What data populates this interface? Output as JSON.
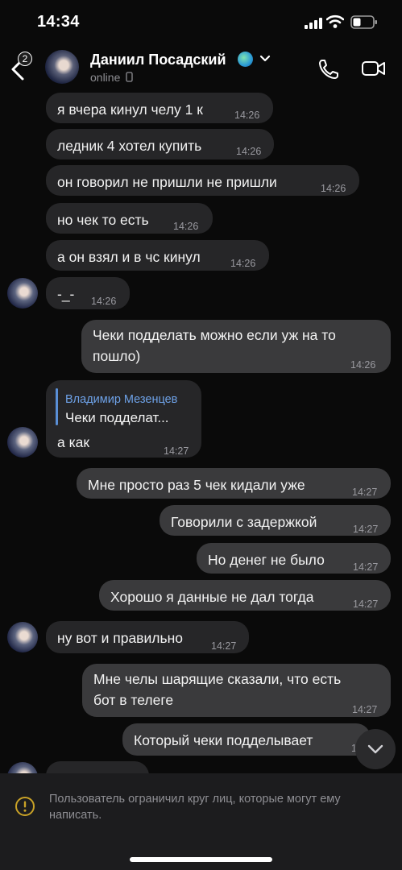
{
  "status_bar": {
    "time": "14:34"
  },
  "header": {
    "back_badge": "2",
    "contact_name": "Даниил Посадский",
    "status": "online",
    "icons": [
      "back-chevron-icon",
      "globe-emoji-icon",
      "chevron-down-icon",
      "phone-icon",
      "video-camera-icon"
    ]
  },
  "messages": [
    {
      "dir": "in",
      "text": "я вчера кинул челу 1 к",
      "time": "14:26"
    },
    {
      "dir": "in",
      "text": "ледник 4 хотел купить",
      "time": "14:26"
    },
    {
      "dir": "in",
      "text": "он говорил не пришли не пришли",
      "time": "14:26"
    },
    {
      "dir": "in",
      "text": "но чек то есть",
      "time": "14:26"
    },
    {
      "dir": "in",
      "text": "а он взял и в чс кинул",
      "time": "14:26"
    },
    {
      "dir": "in",
      "text": "-_-",
      "time": "14:26"
    },
    {
      "dir": "out",
      "line1": "Чеки подделать можно если уж на то",
      "line2": "пошло)",
      "time": "14:26"
    },
    {
      "dir": "in",
      "reply_author": "Владимир Мезенцев",
      "reply_text": "Чеки подделат...",
      "text": "а как",
      "time": "14:27"
    },
    {
      "dir": "out",
      "text": "Мне просто раз 5 чек кидали уже",
      "time": "14:27"
    },
    {
      "dir": "out",
      "text": "Говорили с задержкой",
      "time": "14:27"
    },
    {
      "dir": "out",
      "text": "Но денег не было",
      "time": "14:27"
    },
    {
      "dir": "out",
      "text": "Хорошо я данные не дал тогда",
      "time": "14:27"
    },
    {
      "dir": "in",
      "text": "ну вот и правильно",
      "time": "14:27"
    },
    {
      "dir": "out",
      "line1": "Мне челы шарящие сказали, что есть",
      "line2": "бот в телеге",
      "time": "14:27"
    },
    {
      "dir": "out",
      "text": "Который чеки подделывает",
      "time": "1"
    }
  ],
  "restriction": {
    "text": "Пользователь ограничил круг лиц, которые могут ему написать.",
    "accent": "#c9a227"
  }
}
